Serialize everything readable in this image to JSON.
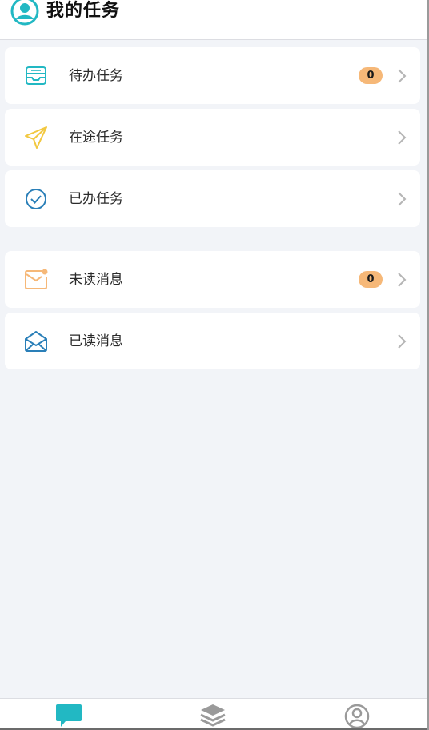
{
  "header": {
    "title": "我的任务",
    "icon": "user-circle-icon"
  },
  "tasks": [
    {
      "label": "待办任务",
      "icon": "inbox-tray-icon",
      "badge": "0"
    },
    {
      "label": "在途任务",
      "icon": "paper-plane-icon"
    },
    {
      "label": "已办任务",
      "icon": "check-circle-icon"
    }
  ],
  "messages": [
    {
      "label": "未读消息",
      "icon": "envelope-unread-icon",
      "badge": "0"
    },
    {
      "label": "已读消息",
      "icon": "envelope-open-icon"
    }
  ],
  "tabbar": {
    "items": [
      {
        "icon": "chat-bubble-icon",
        "active": true
      },
      {
        "icon": "layers-icon",
        "active": false
      },
      {
        "icon": "user-circle-icon",
        "active": false
      }
    ]
  },
  "colors": {
    "accent": "#22b8c3",
    "badge": "#f6b878",
    "plane": "#f2c840",
    "check": "#2a7fb8",
    "envelope_unread": "#f6b878",
    "envelope_read": "#2a7fb8",
    "background": "#f2f4f8"
  }
}
